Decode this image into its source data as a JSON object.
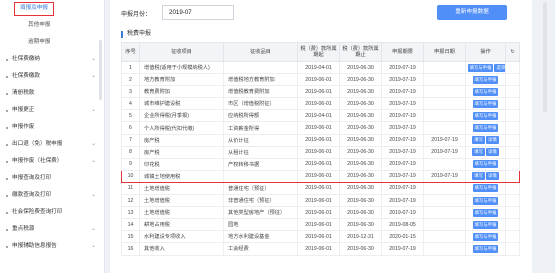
{
  "sidebar": {
    "items": [
      {
        "label": "填报及申报",
        "type": "active",
        "chev": ""
      },
      {
        "label": "其他申报",
        "type": "sub",
        "chev": ""
      },
      {
        "label": "逾期申报",
        "type": "sub",
        "chev": ""
      },
      {
        "label": "社保费缴纳",
        "type": "main",
        "chev": "⌄"
      },
      {
        "label": "社保费缴款",
        "type": "main",
        "chev": "⌄"
      },
      {
        "label": "清册税款",
        "type": "main",
        "chev": ""
      },
      {
        "label": "申报更正",
        "type": "main",
        "chev": "⌄"
      },
      {
        "label": "申报作废",
        "type": "main",
        "chev": ""
      },
      {
        "label": "出口退（免）税申报",
        "type": "main",
        "chev": "⌄"
      },
      {
        "label": "申报作废（社保费）",
        "type": "main",
        "chev": "⌄"
      },
      {
        "label": "申报查询及打印",
        "type": "main",
        "chev": ""
      },
      {
        "label": "缴款查询及打印",
        "type": "main",
        "chev": "⌄"
      },
      {
        "label": "社会保险费查询打印",
        "type": "main",
        "chev": ""
      },
      {
        "label": "重点税源",
        "type": "main",
        "chev": "⌄"
      },
      {
        "label": "申报辅助信息报告",
        "type": "main",
        "chev": "⌄"
      }
    ]
  },
  "topbar": {
    "period_label": "申报月份：",
    "period_value": "2019-07",
    "reread_label": "重新申报数据"
  },
  "section_title": "税费申报",
  "table": {
    "headers": [
      "序号",
      "征收项目",
      "征收品目",
      "税（费）款所属期起",
      "税（费）款所属期止",
      "申报期限",
      "申报日期",
      "操作",
      "↻"
    ],
    "rows": [
      {
        "no": "1",
        "item": "增值税(适用于小规模纳税人)",
        "sub": "",
        "start": "2019-04-01",
        "end": "2019-06-30",
        "due": "2019-07-19",
        "date": "",
        "ops": [
          "填写与申报",
          "选单"
        ],
        "hl": false
      },
      {
        "no": "2",
        "item": "地方教育附加",
        "sub": "增值税地方教育附加",
        "start": "2019-06-01",
        "end": "2019-06-30",
        "due": "2019-07-19",
        "date": "",
        "ops": [
          "填写与申报"
        ],
        "hl": false
      },
      {
        "no": "3",
        "item": "教育费附加",
        "sub": "增值税教育费附加",
        "start": "2019-06-01",
        "end": "2019-06-30",
        "due": "2019-07-19",
        "date": "",
        "ops": [
          "填写与申报"
        ],
        "hl": false
      },
      {
        "no": "4",
        "item": "城市维护建设税",
        "sub": "市区（增值税附征）",
        "start": "2019-06-01",
        "end": "2019-06-30",
        "due": "2019-07-19",
        "date": "",
        "ops": [
          "填写与申报"
        ],
        "hl": false
      },
      {
        "no": "5",
        "item": "企业所得税(月季报)",
        "sub": "应纳税所得额",
        "start": "2019-04-01",
        "end": "2019-06-30",
        "due": "2019-07-19",
        "date": "",
        "ops": [
          "填写与申报"
        ],
        "hl": false
      },
      {
        "no": "6",
        "item": "个人所得税(代扣代缴)",
        "sub": "工资薪金所得",
        "start": "2019-06-01",
        "end": "2019-06-30",
        "due": "2019-07-19",
        "date": "",
        "ops": [
          "填写与申报"
        ],
        "hl": false
      },
      {
        "no": "7",
        "item": "房产税",
        "sub": "从价计征",
        "start": "2019-06-01",
        "end": "2019-06-30",
        "due": "2019-07-19",
        "date": "2019-07-19",
        "ops": [
          "填写",
          "详情"
        ],
        "hl": false
      },
      {
        "no": "8",
        "item": "房产税",
        "sub": "从租计征",
        "start": "2019-06-01",
        "end": "2019-06-30",
        "due": "2019-07-19",
        "date": "2019-07-19",
        "ops": [
          "填写",
          "详情"
        ],
        "hl": false
      },
      {
        "no": "9",
        "item": "印花税",
        "sub": "产权转移书据",
        "start": "2019-06-01",
        "end": "2019-06-30",
        "due": "2019-07-19",
        "date": "",
        "ops": [
          "填写与申报"
        ],
        "hl": false
      },
      {
        "no": "10",
        "item": "城镇土地使用税",
        "sub": "",
        "start": "2019-06-01",
        "end": "2019-06-30",
        "due": "2019-07-19",
        "date": "2019-07-19",
        "ops": [
          "填写",
          "详情"
        ],
        "hl": true
      },
      {
        "no": "11",
        "item": "土地增值税",
        "sub": "普通住宅（预征）",
        "start": "2019-06-01",
        "end": "2019-06-30",
        "due": "2019-07-19",
        "date": "",
        "ops": [
          "填写与申报"
        ],
        "hl": false
      },
      {
        "no": "12",
        "item": "土地增值税",
        "sub": "非普通住宅（预征）",
        "start": "2019-06-01",
        "end": "2019-06-30",
        "due": "2019-07-19",
        "date": "",
        "ops": [
          "填写与申报"
        ],
        "hl": false
      },
      {
        "no": "13",
        "item": "土地增值税",
        "sub": "其他类型房地产（预征）",
        "start": "2019-06-01",
        "end": "2019-06-30",
        "due": "2019-07-19",
        "date": "",
        "ops": [
          "填写与申报"
        ],
        "hl": false
      },
      {
        "no": "14",
        "item": "耕地占用税",
        "sub": "园地",
        "start": "2019-06-01",
        "end": "2019-06-30",
        "due": "2019-08-05",
        "date": "",
        "ops": [
          "填写与申报"
        ],
        "hl": false
      },
      {
        "no": "15",
        "item": "水利建设专项收入",
        "sub": "地方水利建设基金",
        "start": "2019-06-01",
        "end": "2019-12-31",
        "due": "2020-01-15",
        "date": "",
        "ops": [
          "填写与申报"
        ],
        "hl": false
      },
      {
        "no": "16",
        "item": "其他收入",
        "sub": "工会经费",
        "start": "2019-06-01",
        "end": "2019-06-30",
        "due": "2019-07-19",
        "date": "",
        "ops": [
          "填写与申报"
        ],
        "hl": false
      }
    ]
  },
  "colors": {
    "accent": "#4f8ff7",
    "highlight": "#e8323a"
  }
}
